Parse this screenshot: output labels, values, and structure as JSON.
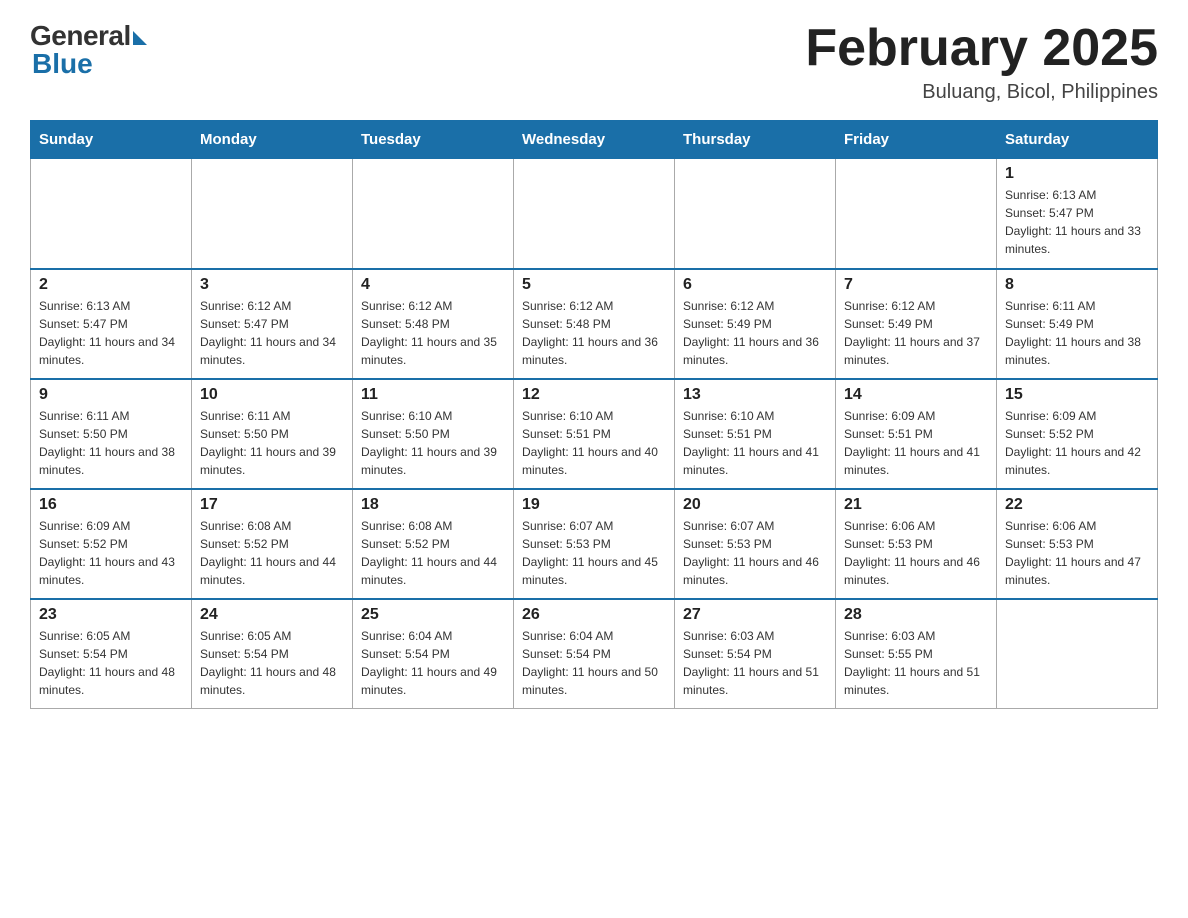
{
  "logo": {
    "general": "General",
    "blue": "Blue"
  },
  "title": "February 2025",
  "location": "Buluang, Bicol, Philippines",
  "weekdays": [
    "Sunday",
    "Monday",
    "Tuesday",
    "Wednesday",
    "Thursday",
    "Friday",
    "Saturday"
  ],
  "weeks": [
    [
      {
        "day": "",
        "sunrise": "",
        "sunset": "",
        "daylight": ""
      },
      {
        "day": "",
        "sunrise": "",
        "sunset": "",
        "daylight": ""
      },
      {
        "day": "",
        "sunrise": "",
        "sunset": "",
        "daylight": ""
      },
      {
        "day": "",
        "sunrise": "",
        "sunset": "",
        "daylight": ""
      },
      {
        "day": "",
        "sunrise": "",
        "sunset": "",
        "daylight": ""
      },
      {
        "day": "",
        "sunrise": "",
        "sunset": "",
        "daylight": ""
      },
      {
        "day": "1",
        "sunrise": "Sunrise: 6:13 AM",
        "sunset": "Sunset: 5:47 PM",
        "daylight": "Daylight: 11 hours and 33 minutes."
      }
    ],
    [
      {
        "day": "2",
        "sunrise": "Sunrise: 6:13 AM",
        "sunset": "Sunset: 5:47 PM",
        "daylight": "Daylight: 11 hours and 34 minutes."
      },
      {
        "day": "3",
        "sunrise": "Sunrise: 6:12 AM",
        "sunset": "Sunset: 5:47 PM",
        "daylight": "Daylight: 11 hours and 34 minutes."
      },
      {
        "day": "4",
        "sunrise": "Sunrise: 6:12 AM",
        "sunset": "Sunset: 5:48 PM",
        "daylight": "Daylight: 11 hours and 35 minutes."
      },
      {
        "day": "5",
        "sunrise": "Sunrise: 6:12 AM",
        "sunset": "Sunset: 5:48 PM",
        "daylight": "Daylight: 11 hours and 36 minutes."
      },
      {
        "day": "6",
        "sunrise": "Sunrise: 6:12 AM",
        "sunset": "Sunset: 5:49 PM",
        "daylight": "Daylight: 11 hours and 36 minutes."
      },
      {
        "day": "7",
        "sunrise": "Sunrise: 6:12 AM",
        "sunset": "Sunset: 5:49 PM",
        "daylight": "Daylight: 11 hours and 37 minutes."
      },
      {
        "day": "8",
        "sunrise": "Sunrise: 6:11 AM",
        "sunset": "Sunset: 5:49 PM",
        "daylight": "Daylight: 11 hours and 38 minutes."
      }
    ],
    [
      {
        "day": "9",
        "sunrise": "Sunrise: 6:11 AM",
        "sunset": "Sunset: 5:50 PM",
        "daylight": "Daylight: 11 hours and 38 minutes."
      },
      {
        "day": "10",
        "sunrise": "Sunrise: 6:11 AM",
        "sunset": "Sunset: 5:50 PM",
        "daylight": "Daylight: 11 hours and 39 minutes."
      },
      {
        "day": "11",
        "sunrise": "Sunrise: 6:10 AM",
        "sunset": "Sunset: 5:50 PM",
        "daylight": "Daylight: 11 hours and 39 minutes."
      },
      {
        "day": "12",
        "sunrise": "Sunrise: 6:10 AM",
        "sunset": "Sunset: 5:51 PM",
        "daylight": "Daylight: 11 hours and 40 minutes."
      },
      {
        "day": "13",
        "sunrise": "Sunrise: 6:10 AM",
        "sunset": "Sunset: 5:51 PM",
        "daylight": "Daylight: 11 hours and 41 minutes."
      },
      {
        "day": "14",
        "sunrise": "Sunrise: 6:09 AM",
        "sunset": "Sunset: 5:51 PM",
        "daylight": "Daylight: 11 hours and 41 minutes."
      },
      {
        "day": "15",
        "sunrise": "Sunrise: 6:09 AM",
        "sunset": "Sunset: 5:52 PM",
        "daylight": "Daylight: 11 hours and 42 minutes."
      }
    ],
    [
      {
        "day": "16",
        "sunrise": "Sunrise: 6:09 AM",
        "sunset": "Sunset: 5:52 PM",
        "daylight": "Daylight: 11 hours and 43 minutes."
      },
      {
        "day": "17",
        "sunrise": "Sunrise: 6:08 AM",
        "sunset": "Sunset: 5:52 PM",
        "daylight": "Daylight: 11 hours and 44 minutes."
      },
      {
        "day": "18",
        "sunrise": "Sunrise: 6:08 AM",
        "sunset": "Sunset: 5:52 PM",
        "daylight": "Daylight: 11 hours and 44 minutes."
      },
      {
        "day": "19",
        "sunrise": "Sunrise: 6:07 AM",
        "sunset": "Sunset: 5:53 PM",
        "daylight": "Daylight: 11 hours and 45 minutes."
      },
      {
        "day": "20",
        "sunrise": "Sunrise: 6:07 AM",
        "sunset": "Sunset: 5:53 PM",
        "daylight": "Daylight: 11 hours and 46 minutes."
      },
      {
        "day": "21",
        "sunrise": "Sunrise: 6:06 AM",
        "sunset": "Sunset: 5:53 PM",
        "daylight": "Daylight: 11 hours and 46 minutes."
      },
      {
        "day": "22",
        "sunrise": "Sunrise: 6:06 AM",
        "sunset": "Sunset: 5:53 PM",
        "daylight": "Daylight: 11 hours and 47 minutes."
      }
    ],
    [
      {
        "day": "23",
        "sunrise": "Sunrise: 6:05 AM",
        "sunset": "Sunset: 5:54 PM",
        "daylight": "Daylight: 11 hours and 48 minutes."
      },
      {
        "day": "24",
        "sunrise": "Sunrise: 6:05 AM",
        "sunset": "Sunset: 5:54 PM",
        "daylight": "Daylight: 11 hours and 48 minutes."
      },
      {
        "day": "25",
        "sunrise": "Sunrise: 6:04 AM",
        "sunset": "Sunset: 5:54 PM",
        "daylight": "Daylight: 11 hours and 49 minutes."
      },
      {
        "day": "26",
        "sunrise": "Sunrise: 6:04 AM",
        "sunset": "Sunset: 5:54 PM",
        "daylight": "Daylight: 11 hours and 50 minutes."
      },
      {
        "day": "27",
        "sunrise": "Sunrise: 6:03 AM",
        "sunset": "Sunset: 5:54 PM",
        "daylight": "Daylight: 11 hours and 51 minutes."
      },
      {
        "day": "28",
        "sunrise": "Sunrise: 6:03 AM",
        "sunset": "Sunset: 5:55 PM",
        "daylight": "Daylight: 11 hours and 51 minutes."
      },
      {
        "day": "",
        "sunrise": "",
        "sunset": "",
        "daylight": ""
      }
    ]
  ]
}
